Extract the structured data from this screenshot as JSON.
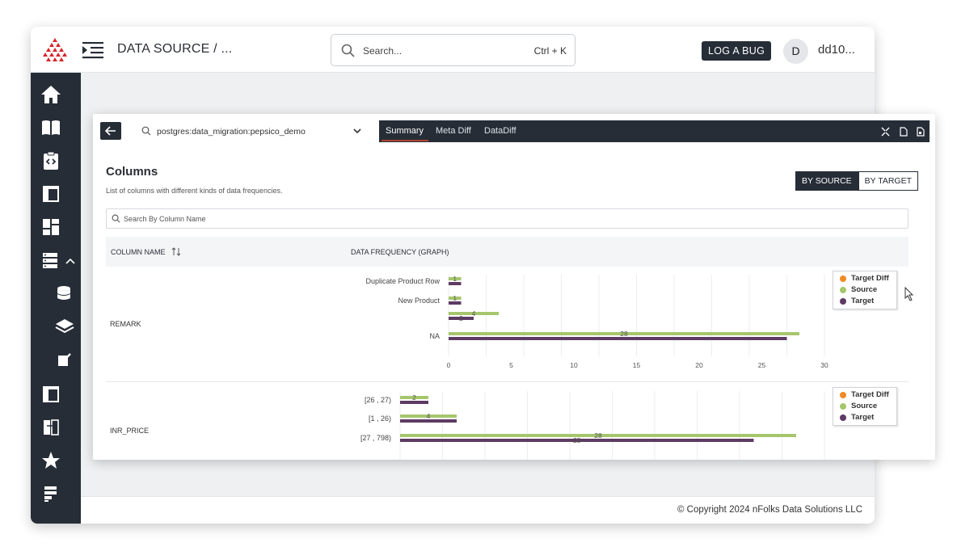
{
  "header": {
    "title": "DATA SOURCE / ...",
    "search_placeholder": "Search...",
    "search_shortcut": "Ctrl + K",
    "bug_button": "LOG  A BUG",
    "avatar_initial": "D",
    "username": "dd10..."
  },
  "footer": {
    "copyright": "© Copyright 2024 nFolks Data Solutions LLC"
  },
  "panel": {
    "datasource": "postgres:data_migration:pepsico_demo",
    "tabs": [
      {
        "label": "Summary",
        "active": true
      },
      {
        "label": "Meta Diff",
        "active": false
      },
      {
        "label": "DataDiff",
        "active": false
      }
    ],
    "columns": {
      "title": "Columns",
      "subtitle": "List of columns with different kinds of data frequencies.",
      "by_source": "BY SOURCE",
      "by_target": "BY TARGET",
      "search_placeholder": "Search By Column Name",
      "col_name_header": "COLUMN NAME",
      "freq_header": "DATA FREQUENCY (GRAPH)"
    },
    "rows": [
      {
        "name": "REMARK"
      },
      {
        "name": "INR_PRICE"
      }
    ]
  },
  "colors": {
    "source": "#a6c66c",
    "target": "#5d3b62",
    "target_diff": "#f08a24",
    "dark": "#262d37"
  },
  "chart_data": [
    {
      "type": "bar",
      "orientation": "horizontal",
      "categories": [
        "Duplicate Product Row",
        "New Product",
        "",
        "NA"
      ],
      "series": [
        {
          "name": "Source",
          "values": [
            1,
            1,
            4,
            28
          ]
        },
        {
          "name": "Target",
          "values": [
            1,
            1,
            2,
            27
          ]
        }
      ],
      "data_labels": [
        {
          "value_label": "1",
          "category": 0,
          "series": "Source"
        },
        {
          "value_label": "1",
          "category": 1,
          "series": "Source"
        },
        {
          "value_label": "4",
          "category": 2,
          "series": "Source"
        },
        {
          "value_label": "2",
          "category": 2,
          "series": "Target"
        },
        {
          "value_label": "28",
          "category": 3,
          "series": "Source"
        }
      ],
      "xticks": [
        0,
        5,
        10,
        15,
        20,
        25,
        30
      ],
      "xlim": [
        0,
        30
      ],
      "legend": [
        "Target Diff",
        "Source",
        "Target"
      ],
      "legend_position": "top-right",
      "grid": true
    },
    {
      "type": "bar",
      "orientation": "horizontal",
      "categories": [
        "[26 , 27)",
        "[1 , 26)",
        "[27 , 798)"
      ],
      "series": [
        {
          "name": "Source",
          "values": [
            2,
            4,
            28
          ]
        },
        {
          "name": "Target",
          "values": [
            2,
            4,
            25
          ]
        }
      ],
      "data_labels": [
        {
          "value_label": "2",
          "category": 0,
          "series": "Source"
        },
        {
          "value_label": "4",
          "category": 1,
          "series": "Source"
        },
        {
          "value_label": "28",
          "category": 2,
          "series": "Source"
        },
        {
          "value_label": "25",
          "category": 2,
          "series": "Target"
        }
      ],
      "xlim": [
        0,
        30
      ],
      "legend": [
        "Target Diff",
        "Source",
        "Target"
      ],
      "legend_position": "top-right",
      "grid": true
    }
  ]
}
